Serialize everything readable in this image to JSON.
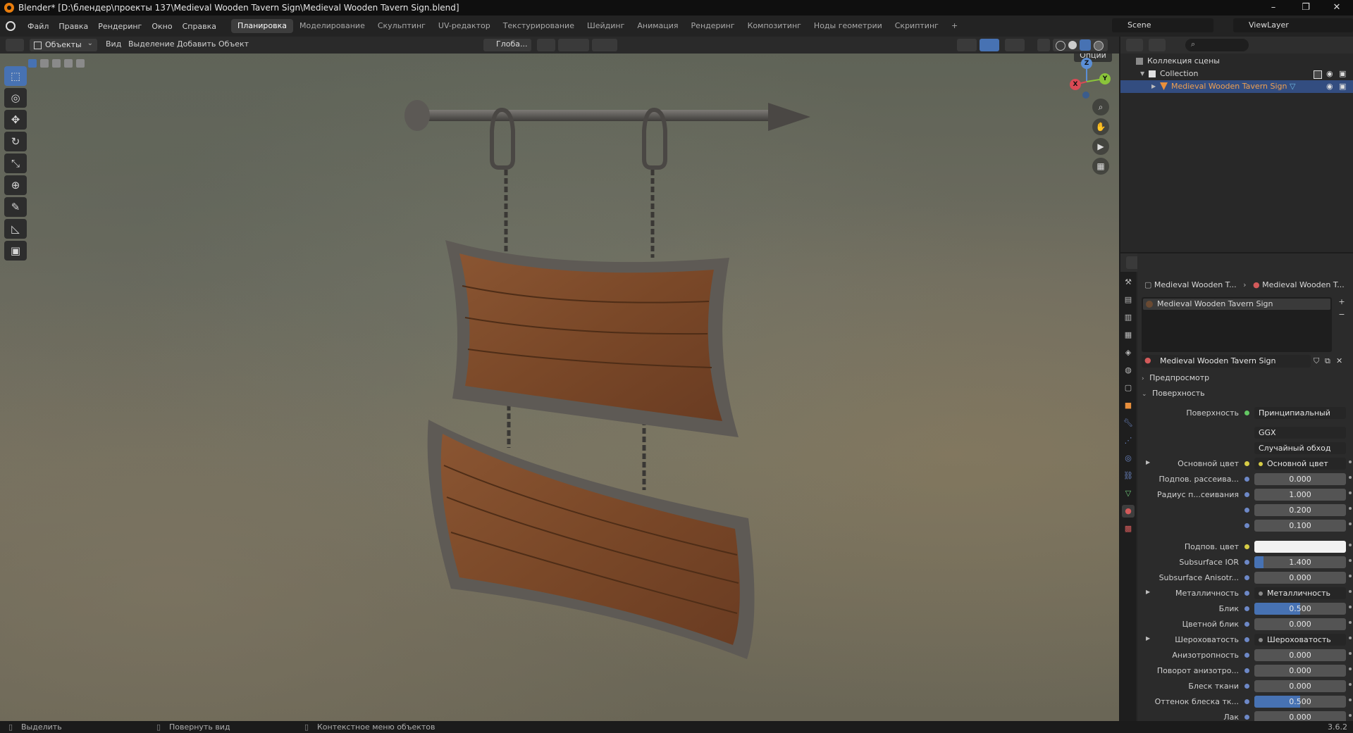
{
  "titlebar": {
    "title": "Blender* [D:\\блендер\\проекты 137\\Medieval Wooden Tavern Sign\\Medieval Wooden Tavern Sign.blend]",
    "minimize": "–",
    "restore": "❐",
    "close": "✕"
  },
  "menu": {
    "items": [
      "Файл",
      "Правка",
      "Рендеринг",
      "Окно",
      "Справка"
    ],
    "workspaces": [
      "Планировка",
      "Моделирование",
      "Скульптинг",
      "UV-редактор",
      "Текстурирование",
      "Шейдинг",
      "Анимация",
      "Рендеринг",
      "Композитинг",
      "Ноды геометрии",
      "Скриптинг"
    ],
    "active_workspace": "Планировка",
    "add_workspace": "+",
    "scene": "Scene",
    "view_layer": "ViewLayer"
  },
  "viewport_header": {
    "mode": "Объекты",
    "menus": [
      "Вид",
      "Выделение",
      "Добавить",
      "Объект"
    ],
    "transform": "Глоба...",
    "options": "Опции"
  },
  "viewport": {
    "tools": [
      "select-box",
      "cursor",
      "move",
      "rotate",
      "scale",
      "transform",
      "annotate",
      "measure",
      "add-cube"
    ],
    "gizmo_axes": [
      "X",
      "Y",
      "Z"
    ],
    "object": "Medieval Wooden Tavern Sign"
  },
  "outliner": {
    "root": "Коллекция сцены",
    "collection": "Collection",
    "object": "Medieval Wooden Tavern Sign"
  },
  "properties": {
    "breadcrumb": [
      "Medieval Wooden T...",
      "Medieval Wooden T..."
    ],
    "material_slot": "Medieval Wooden Tavern Sign",
    "material_name": "Medieval Wooden Tavern Sign",
    "panels": {
      "preview": "Предпросмотр",
      "surface": "Поверхность"
    },
    "surface_label": "Поверхность",
    "surface_value": "Принципиальный BSDF",
    "distribution": "GGX",
    "subsurface_method": "Случайный обход",
    "rows": [
      {
        "label": "Основной цвет",
        "value": "Основной цвет",
        "kind": "link",
        "expand": true
      },
      {
        "label": "Подпов. рассеива...",
        "value": "0.000",
        "kind": "num",
        "fill": 0
      },
      {
        "label": "Радиус п...сеивания",
        "value": "1.000",
        "kind": "num",
        "fill": 0
      },
      {
        "label": "",
        "value": "0.200",
        "kind": "num",
        "fill": 0
      },
      {
        "label": "",
        "value": "0.100",
        "kind": "num",
        "fill": 0
      },
      {
        "label": "Подпов. цвет",
        "value": "",
        "kind": "color"
      },
      {
        "label": "Subsurface IOR",
        "value": "1.400",
        "kind": "num",
        "fill": 0.1
      },
      {
        "label": "Subsurface Anisotr...",
        "value": "0.000",
        "kind": "num",
        "fill": 0
      },
      {
        "label": "Металличность",
        "value": "Металличность",
        "kind": "link",
        "expand": true
      },
      {
        "label": "Блик",
        "value": "0.500",
        "kind": "num",
        "fill": 0.5
      },
      {
        "label": "Цветной блик",
        "value": "0.000",
        "kind": "num",
        "fill": 0
      },
      {
        "label": "Шероховатость",
        "value": "Шероховатость",
        "kind": "link",
        "expand": true
      },
      {
        "label": "Анизотропность",
        "value": "0.000",
        "kind": "num",
        "fill": 0
      },
      {
        "label": "Поворот анизотро...",
        "value": "0.000",
        "kind": "num",
        "fill": 0
      },
      {
        "label": "Блеск ткани",
        "value": "0.000",
        "kind": "num",
        "fill": 0
      },
      {
        "label": "Оттенок блеска тк...",
        "value": "0.500",
        "kind": "num",
        "fill": 0.5
      },
      {
        "label": "Лак",
        "value": "0.000",
        "kind": "num",
        "fill": 0
      }
    ]
  },
  "statusbar": {
    "select": "Выделить",
    "rotate_view": "Повернуть вид",
    "context_menu": "Контекстное меню объектов",
    "version": "3.6.2"
  }
}
